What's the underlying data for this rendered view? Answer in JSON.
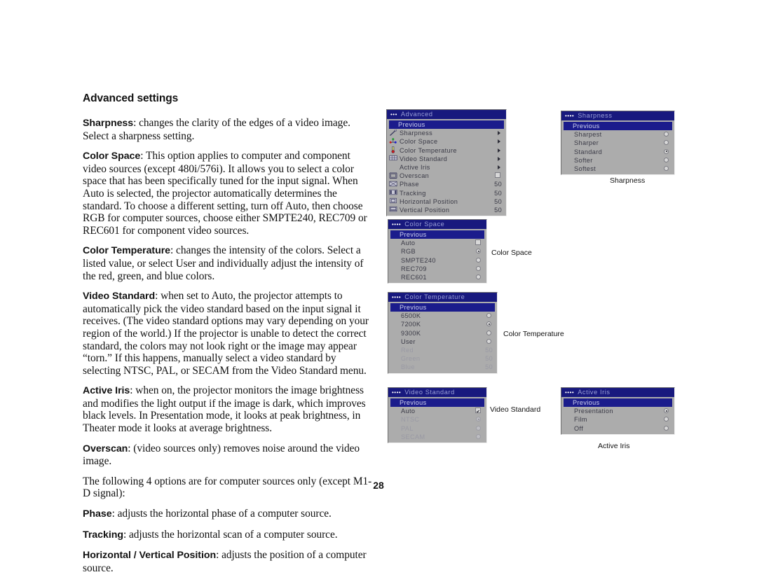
{
  "page": {
    "heading": "Advanced settings",
    "number": "28"
  },
  "paragraphs": [
    {
      "term": "Sharpness",
      "body": ": changes the clarity of the edges of a video image. Select a sharpness setting."
    },
    {
      "term": "Color Space",
      "body": ": This option applies to computer and component video sources (except 480i/576i). It allows you to select a color space that has been specifically tuned for the input signal. When Auto is selected, the projector automatically determines the standard. To choose a different setting, turn off Auto, then choose RGB for computer sources, choose either SMPTE240, REC709 or REC601 for component video sources."
    },
    {
      "term": "Color Temperature",
      "body": ": changes the intensity of the colors. Select a listed value, or select User and individually adjust the intensity of the red, green, and blue colors."
    },
    {
      "term": "Video Standard",
      "body": ": when set to Auto, the projector attempts to automatically pick the video standard based on the input signal it receives. (The video standard options may vary depending on your region of the world.) If the projector is unable to detect the correct standard, the colors may not look right or the image may appear “torn.” If this happens, manually select a video standard by selecting NTSC, PAL, or SECAM from the Video Standard menu."
    },
    {
      "term": "Active Iris",
      "body": ": when on, the projector monitors the image brightness and modifies the light output if the image is dark, which improves black levels. In Presentation mode, it looks at peak brightness, in Theater mode it looks at average brightness."
    },
    {
      "term": "Overscan",
      "body": ": (video sources only) removes noise around the video image."
    },
    {
      "term": "",
      "body": "The following 4 options are for computer sources only (except M1-D signal):"
    },
    {
      "term": "Phase",
      "body": ": adjusts the horizontal phase of a computer source."
    },
    {
      "term": "Tracking",
      "body": ": adjusts the horizontal scan of a computer source."
    },
    {
      "term": "Horizontal / Vertical Position",
      "body": ": adjusts the position of a computer source."
    }
  ],
  "colors": {
    "osd_title_bg": "#18197e",
    "osd_highlight_bg": "#1b1c8c",
    "osd_body_bg": "#acacac",
    "osd_text": "#3a3a46",
    "osd_text_disabled": "#9a9aa4"
  },
  "menus": {
    "advanced": {
      "dots": "•••",
      "title": "Advanced",
      "previous": "Previous",
      "rows": [
        {
          "icon": "sharpness-wand-icon",
          "label": "Sharpness",
          "control": "arrow",
          "value": ""
        },
        {
          "icon": "color-space-dots-icon",
          "label": "Color Space",
          "control": "arrow",
          "value": ""
        },
        {
          "icon": "thermometer-icon",
          "label": "Color Temperature",
          "control": "arrow",
          "value": ""
        },
        {
          "icon": "video-standard-icon",
          "label": "Video Standard",
          "control": "arrow",
          "value": ""
        },
        {
          "icon": "none",
          "label": "Active Iris",
          "control": "arrow",
          "value": ""
        },
        {
          "icon": "overscan-frame-icon",
          "label": "Overscan",
          "control": "checkbox-off",
          "value": ""
        },
        {
          "icon": "phase-icon",
          "label": "Phase",
          "control": "value",
          "value": "50"
        },
        {
          "icon": "tracking-icon",
          "label": "Tracking",
          "control": "value",
          "value": "50"
        },
        {
          "icon": "horizontal-position-icon",
          "label": "Horizontal Position",
          "control": "value",
          "value": "50"
        },
        {
          "icon": "vertical-position-icon",
          "label": "Vertical Position",
          "control": "value",
          "value": "50"
        }
      ]
    },
    "sharpness": {
      "dots": "••••",
      "title": "Sharpness",
      "caption": "Sharpness",
      "previous": "Previous",
      "rows": [
        {
          "label": "Sharpest",
          "control": "radio",
          "selected": false,
          "disabled": false
        },
        {
          "label": "Sharper",
          "control": "radio",
          "selected": false,
          "disabled": false
        },
        {
          "label": "Standard",
          "control": "radio",
          "selected": true,
          "disabled": false
        },
        {
          "label": "Softer",
          "control": "radio",
          "selected": false,
          "disabled": false
        },
        {
          "label": "Softest",
          "control": "radio",
          "selected": false,
          "disabled": false
        }
      ]
    },
    "color_space": {
      "dots": "••••",
      "title": "Color Space",
      "caption": "Color Space",
      "previous": "Previous",
      "rows": [
        {
          "label": "Auto",
          "control": "checkbox",
          "selected": false,
          "disabled": false
        },
        {
          "label": "RGB",
          "control": "radio",
          "selected": true,
          "disabled": false
        },
        {
          "label": "SMPTE240",
          "control": "radio",
          "selected": false,
          "disabled": false
        },
        {
          "label": "REC709",
          "control": "radio",
          "selected": false,
          "disabled": false
        },
        {
          "label": "REC601",
          "control": "radio",
          "selected": false,
          "disabled": false
        }
      ]
    },
    "color_temperature": {
      "dots": "••••",
      "title": "Color Temperature",
      "caption": "Color Temperature",
      "previous": "Previous",
      "rows": [
        {
          "label": "6500K",
          "control": "radio",
          "selected": false,
          "disabled": false,
          "value": ""
        },
        {
          "label": "7200K",
          "control": "radio",
          "selected": true,
          "disabled": false,
          "value": ""
        },
        {
          "label": "9300K",
          "control": "radio",
          "selected": false,
          "disabled": false,
          "value": ""
        },
        {
          "label": "User",
          "control": "radio",
          "selected": false,
          "disabled": false,
          "value": ""
        },
        {
          "label": "Red",
          "control": "value",
          "selected": false,
          "disabled": true,
          "value": "50"
        },
        {
          "label": "Green",
          "control": "value",
          "selected": false,
          "disabled": true,
          "value": "50"
        },
        {
          "label": "Blue",
          "control": "value",
          "selected": false,
          "disabled": true,
          "value": "50"
        }
      ]
    },
    "video_standard": {
      "dots": "••••",
      "title": "Video Standard",
      "caption": "Video Standard",
      "previous": "Previous",
      "rows": [
        {
          "label": "Auto",
          "control": "checkbox",
          "selected": true,
          "disabled": false
        },
        {
          "label": "NTSC",
          "control": "radio",
          "selected": true,
          "disabled": true
        },
        {
          "label": "PAL",
          "control": "radio",
          "selected": false,
          "disabled": true
        },
        {
          "label": "SECAM",
          "control": "radio",
          "selected": false,
          "disabled": true
        }
      ]
    },
    "active_iris": {
      "dots": "••••",
      "title": "Active Iris",
      "caption": "Active Iris",
      "previous": "Previous",
      "rows": [
        {
          "label": "Presentation",
          "control": "radio",
          "selected": true,
          "disabled": false
        },
        {
          "label": "Film",
          "control": "radio",
          "selected": false,
          "disabled": false
        },
        {
          "label": "Off",
          "control": "radio",
          "selected": false,
          "disabled": false
        }
      ]
    }
  }
}
